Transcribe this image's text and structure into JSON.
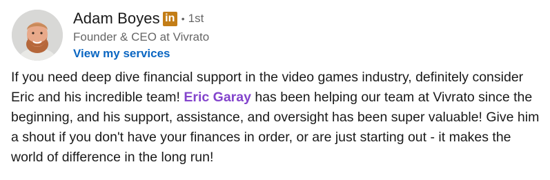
{
  "author": {
    "name": "Adam Boyes",
    "badge_text": "in",
    "separator": "•",
    "connection_degree": "1st",
    "headline": "Founder & CEO at Vivrato",
    "services_link": "View my services"
  },
  "post": {
    "text_before_mention": "If you need deep dive financial support in the video games industry, definitely consider Eric and his incredible team! ",
    "mention": "Eric Garay",
    "text_after_mention": " has been helping our team at Vivrato since the beginning, and his support, assistance, and oversight has been super valuable! Give him a shout if you don't have your finances in order, or are just starting out - it makes the world of difference in the long run!"
  },
  "colors": {
    "link_blue": "#0a66c2",
    "mention_purple": "#8344cc",
    "badge_gold": "#c37d16",
    "secondary_text": "#666666",
    "primary_text": "#191919"
  }
}
